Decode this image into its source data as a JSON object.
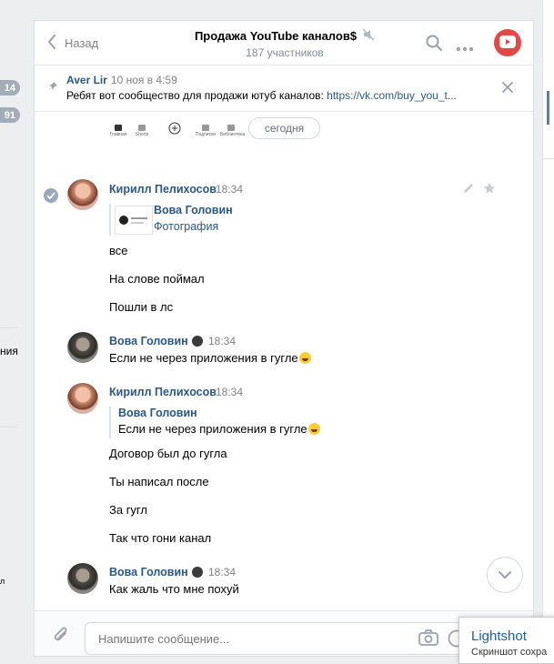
{
  "sidebar": {
    "badges": [
      "14",
      "91"
    ],
    "fragments": [
      "ния",
      "л"
    ]
  },
  "header": {
    "back_label": "Назад",
    "title": "Продажа YouTube каналов$",
    "subtitle": "187 участников"
  },
  "pinned": {
    "author": "Aver Lir",
    "date": "10 ноя в 4:59",
    "text": "Ребят вот сообщество для продажи ютуб каналов: ",
    "link": "https://vk.com/buy_you_t..."
  },
  "sticker_strip": {
    "items": [
      "Главная",
      "Shorts",
      "",
      "Подписки",
      "Библиотека"
    ]
  },
  "date_divider": "сегодня",
  "messages": [
    {
      "author": "Кирилл Пелихосов",
      "time": "18:34",
      "quote": {
        "author": "Вова Головин",
        "text": "Фотография"
      },
      "lines": [
        "все",
        "На слове поймал",
        "Пошли в лс"
      ]
    },
    {
      "author": "Вова Головин",
      "time": "18:34",
      "lines": [
        "Если не через приложения в гугле"
      ]
    },
    {
      "author": "Кирилл Пелихосов",
      "time": "18:34",
      "quote": {
        "author": "Вова Головин",
        "text": "Если не через приложения в гугле"
      },
      "lines": [
        "Договор был до гугла",
        "Ты написал после",
        "За гугл",
        "Так что гони канал"
      ]
    },
    {
      "author": "Вова Головин",
      "time": "18:34",
      "lines": [
        "Как жаль что мне похуй"
      ]
    }
  ],
  "composer": {
    "placeholder": "Напишите сообщение..."
  },
  "lightshot": {
    "title": "Lightshot",
    "subtitle": "Скриншот сохра"
  },
  "colors": {
    "link": "#2a5885",
    "meta": "#828282",
    "background": "#edeef0",
    "header_avatar": "#e64646"
  },
  "icons": [
    "chevron-left-icon",
    "mute-icon",
    "search-icon",
    "more-icon",
    "youtube-icon",
    "pin-icon",
    "close-icon",
    "check-icon",
    "edit-icon",
    "star-icon",
    "chevron-down-icon",
    "paperclip-icon",
    "camera-icon",
    "smile-icon"
  ]
}
